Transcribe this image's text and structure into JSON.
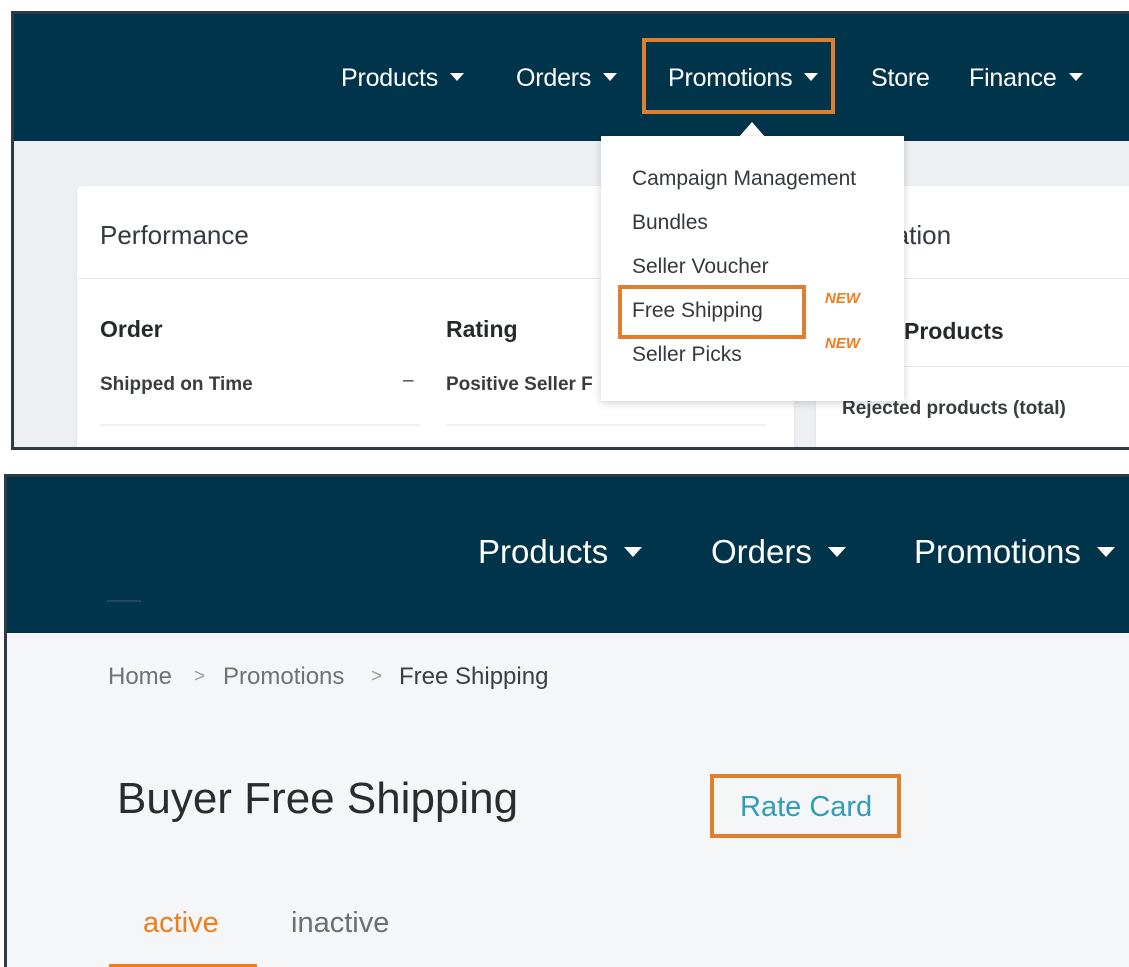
{
  "top": {
    "nav": [
      {
        "label": "Products",
        "dropdown": true
      },
      {
        "label": "Orders",
        "dropdown": true
      },
      {
        "label": "Promotions",
        "dropdown": true
      },
      {
        "label": "Store",
        "dropdown": false
      },
      {
        "label": "Finance",
        "dropdown": true
      }
    ],
    "promotions_menu": [
      {
        "label": "Campaign Management",
        "badge": ""
      },
      {
        "label": "Bundles",
        "badge": ""
      },
      {
        "label": "Seller Voucher",
        "badge": ""
      },
      {
        "label": "Free Shipping",
        "badge": "NEW"
      },
      {
        "label": "Seller Picks",
        "badge": "NEW"
      }
    ],
    "performance": {
      "title": "Performance",
      "order_title": "Order",
      "order_metric": "Shipped on Time",
      "order_value": "–",
      "rating_title": "Rating",
      "rating_metric": "Positive Seller F"
    },
    "right_card": {
      "title_fragment": "ration",
      "section_fragment": "Products",
      "metric": "Rejected products (total)"
    }
  },
  "bottom": {
    "nav": [
      {
        "label": "Products"
      },
      {
        "label": "Orders"
      },
      {
        "label": "Promotions"
      }
    ],
    "breadcrumb": [
      "Home",
      "Promotions",
      "Free Shipping"
    ],
    "breadcrumb_sep": ">",
    "title": "Buyer Free Shipping",
    "rate_card": "Rate Card",
    "tabs": [
      {
        "label": "active",
        "selected": true
      },
      {
        "label": "inactive",
        "selected": false
      }
    ]
  },
  "colors": {
    "nav_bg": "#00344a",
    "highlight": "#e07f2e",
    "accent": "#f07d1c",
    "link": "#2f9cba"
  }
}
